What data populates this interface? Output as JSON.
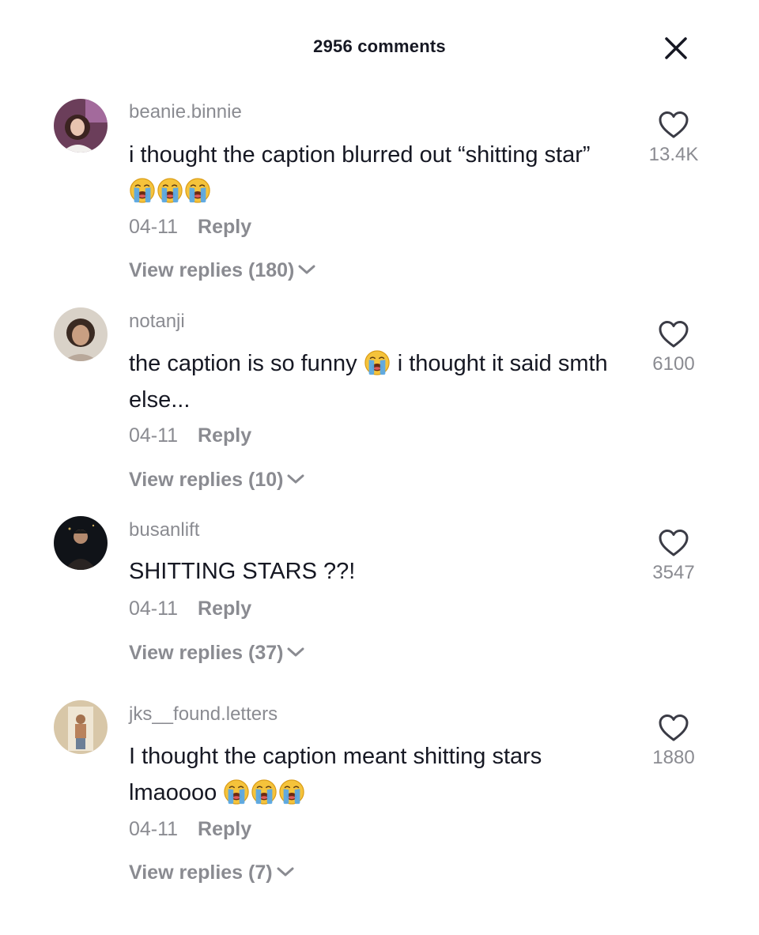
{
  "header": {
    "title": "2956 comments",
    "close_icon": "close-icon"
  },
  "colors": {
    "primary_text": "#161823",
    "secondary_text": "#8a8b91",
    "background": "#ffffff"
  },
  "comments": [
    {
      "username": "beanie.binnie",
      "text": "i thought the caption blurred out “shitting star”",
      "trailing_emoji": [
        "loudly-crying-face",
        "loudly-crying-face",
        "loudly-crying-face"
      ],
      "date": "04-11",
      "reply_label": "Reply",
      "view_replies": "View replies (180)",
      "likes": "13.4K"
    },
    {
      "username": "notanji",
      "text_before_emoji": "the caption is so funny",
      "text_after_emoji": "i thought it said smth else...",
      "inline_emoji": "loudly-crying-face",
      "date": "04-11",
      "reply_label": "Reply",
      "view_replies": "View replies (10)",
      "likes": "6100"
    },
    {
      "username": "busanlift",
      "text": "SHITTING STARS ??!",
      "date": "04-11",
      "reply_label": "Reply",
      "view_replies": "View replies (37)",
      "likes": "3547"
    },
    {
      "username": "jks__found.letters",
      "text": "I thought the caption meant shitting stars lmaoooo",
      "trailing_emoji": [
        "loudly-crying-face",
        "loudly-crying-face",
        "loudly-crying-face"
      ],
      "date": "04-11",
      "reply_label": "Reply",
      "view_replies": "View replies (7)",
      "likes": "1880"
    }
  ]
}
